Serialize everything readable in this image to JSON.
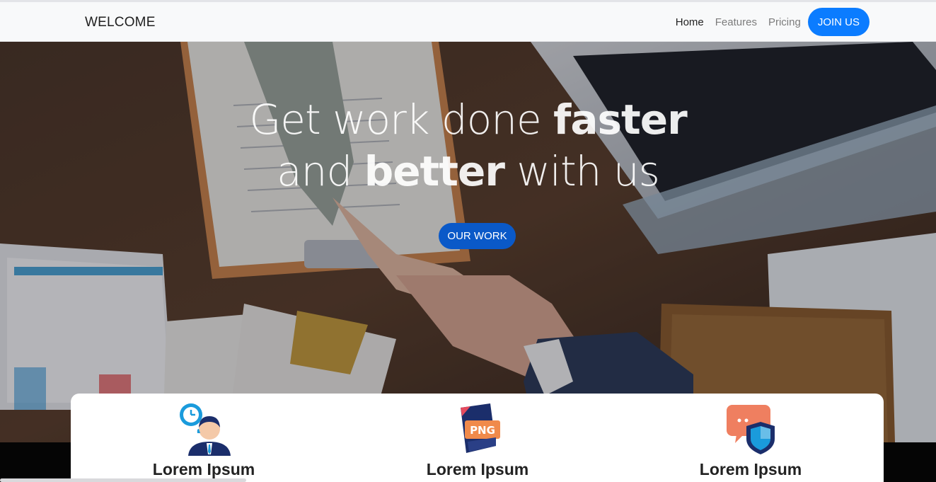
{
  "navbar": {
    "brand": "WELCOME",
    "links": [
      {
        "label": "Home"
      },
      {
        "label": "Features"
      },
      {
        "label": "Pricing"
      }
    ],
    "cta": "JOIN US"
  },
  "hero": {
    "line1_light": "Get work done ",
    "line1_bold": "faster",
    "line2_light_a": "and ",
    "line2_bold": "better",
    "line2_light_b": " with us",
    "button": "OUR WORK"
  },
  "features": [
    {
      "title": "Lorem Ipsum",
      "icon": "clock-person-icon"
    },
    {
      "title": "Lorem Ipsum",
      "icon": "png-file-icon"
    },
    {
      "title": "Lorem Ipsum",
      "icon": "chat-shield-icon"
    }
  ],
  "colors": {
    "accent": "#0b7cff",
    "hero_button": "#0a59c8",
    "navbar_bg": "#f8f9fa"
  }
}
